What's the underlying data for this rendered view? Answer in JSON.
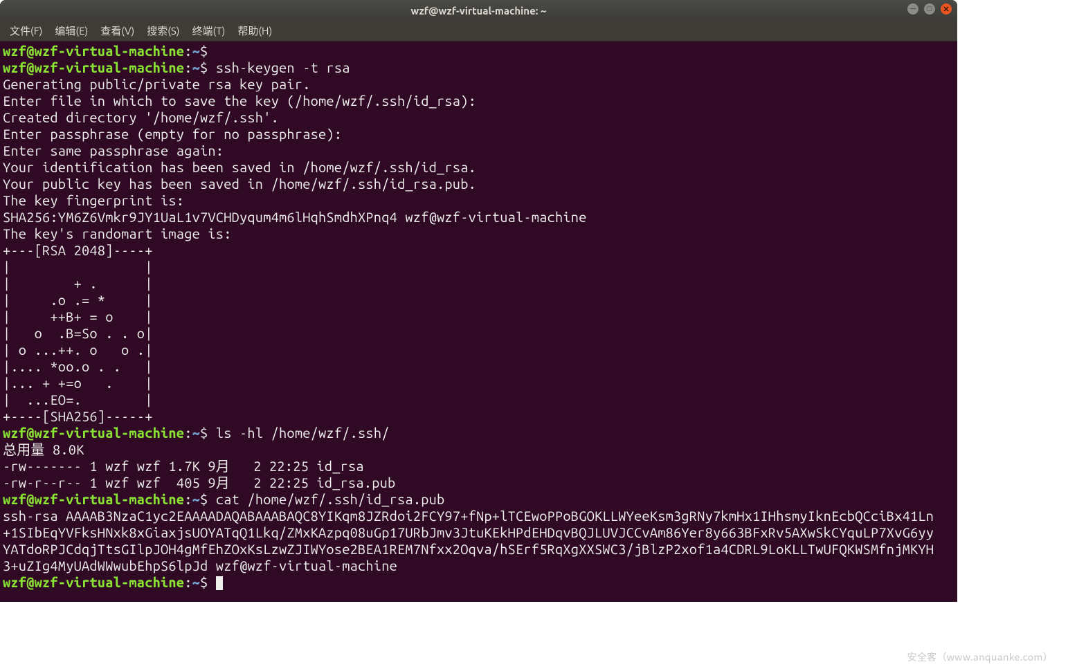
{
  "titlebar": {
    "title": "wzf@wzf-virtual-machine: ~"
  },
  "menubar": {
    "file": "文件(F)",
    "edit": "编辑(E)",
    "view": "查看(V)",
    "search": "搜索(S)",
    "terminal": "终端(T)",
    "help": "帮助(H)"
  },
  "prompt": {
    "userhost": "wzf@wzf-virtual-machine",
    "sep": ":",
    "path": "~",
    "sym": "$"
  },
  "lines": {
    "cmd1": " ",
    "cmd2": " ssh-keygen -t rsa",
    "l1": "Generating public/private rsa key pair.",
    "l2": "Enter file in which to save the key (/home/wzf/.ssh/id_rsa): ",
    "l3": "Created directory '/home/wzf/.ssh'.",
    "l4": "Enter passphrase (empty for no passphrase): ",
    "l5": "Enter same passphrase again: ",
    "l6": "Your identification has been saved in /home/wzf/.ssh/id_rsa.",
    "l7": "Your public key has been saved in /home/wzf/.ssh/id_rsa.pub.",
    "l8": "The key fingerprint is:",
    "l9": "SHA256:YM6Z6Vmkr9JY1UaL1v7VCHDyqum4m6lHqhSmdhXPnq4 wzf@wzf-virtual-machine",
    "l10": "The key's randomart image is:",
    "r1": "+---[RSA 2048]----+",
    "r2": "|                 |",
    "r3": "|        + .      |",
    "r4": "|     .o .= *     |",
    "r5": "|     ++B+ = o    |",
    "r6": "|   o  .B=So . . o|",
    "r7": "| o ...++. o   o .|",
    "r8": "|.... *oo.o . .   |",
    "r9": "|... + +=o   .    |",
    "r10": "|  ...EO=.        |",
    "r11": "+----[SHA256]-----+",
    "cmd3": " ls -hl /home/wzf/.ssh/",
    "tot": "总用量 8.0K",
    "ls1": "-rw------- 1 wzf wzf 1.7K 9月   2 22:25 id_rsa",
    "ls2": "-rw-r--r-- 1 wzf wzf  405 9月   2 22:25 id_rsa.pub",
    "cmd4": " cat /home/wzf/.ssh/id_rsa.pub",
    "pub1": "ssh-rsa AAAAB3NzaC1yc2EAAAADAQABAAABAQC8YIKqm8JZRdoi2FCY97+fNp+lTCEwoPPoBGOKLLWYeeKsm3gRNy7kmHx1IHhsmyIknEcbQCciBx41Ln",
    "pub2": "+1SIbEqYVFksHNxk8xGiaxjsUOYATqQ1Lkq/ZMxKAzpq08uGp17URbJmv3JtuKEkHPdEHDqvBQJLUVJCCvAm86Yer8y663BFxRv5AXwSkCYquLP7XvG6yy",
    "pub3": "YATdoRPJCdqjTtsGIlpJOH4gMfEhZOxKsLzwZJIWYose2BEA1REM7Nfxx2Oqva/hSErf5RqXgXXSWC3/jBlzP2xof1a4CDRL9LoKLLTwUFQKWSMfnjMKYH",
    "pub4": "3+uZIg4MyUAdWWwubEhpS6lpJd wzf@wzf-virtual-machine",
    "cmd5": " "
  },
  "watermark": {
    "text": "安全客（www.anquanke.com）"
  }
}
